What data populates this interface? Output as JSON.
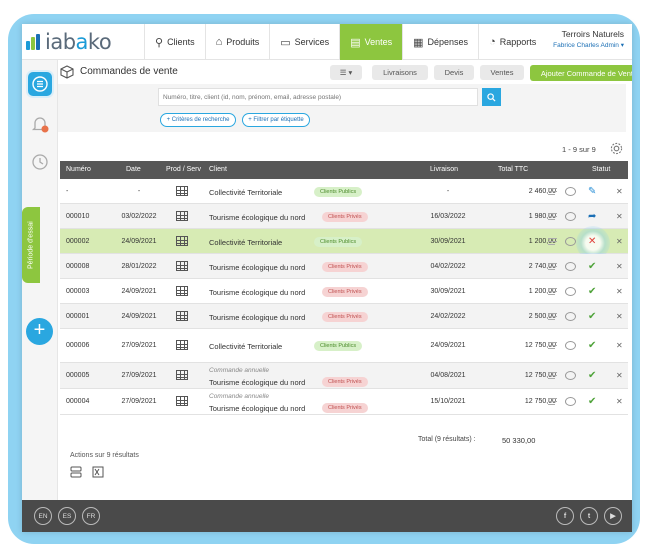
{
  "brand": {
    "logo_text_a": "iab",
    "logo_text_b": "a",
    "logo_text_c": "ko"
  },
  "nav": [
    {
      "label": "Clients",
      "icon": "person-icon"
    },
    {
      "label": "Produits",
      "icon": "tag-icon"
    },
    {
      "label": "Services",
      "icon": "briefcase-icon"
    },
    {
      "label": "Ventes",
      "icon": "document-icon",
      "active": true
    },
    {
      "label": "Dépenses",
      "icon": "calculator-icon"
    },
    {
      "label": "Rapports",
      "icon": "pie-chart-icon"
    }
  ],
  "account": {
    "company": "Terroirs Naturels",
    "user": "Fabrice Charles Admin"
  },
  "sidebar": {
    "trial_label": "Période d'essai",
    "notification_count": "6"
  },
  "page": {
    "title": "Commandes de vente",
    "buttons": {
      "livraisons": "Livraisons",
      "devis": "Devis",
      "ventes": "Ventes",
      "add": "Ajouter Commande de Vente"
    }
  },
  "search": {
    "placeholder": "Numéro, titre, client (id, nom, prénom, email, adresse postale)",
    "criteria_label": "+ Critères de recherche",
    "filter_label": "+ Filtrer par étiquette"
  },
  "pager": "1 - 9 sur 9",
  "table": {
    "headers": {
      "numero": "Numéro",
      "date": "Date",
      "prod": "Prod / Serv",
      "client": "Client",
      "livraison": "Livraison",
      "ttc": "Total TTC",
      "statut": "Statut"
    },
    "rows": [
      {
        "numero": "-",
        "date": "-",
        "sub": "",
        "client": "Collectivité Territoriale",
        "tag": "Clients Publics",
        "tag_type": "pub",
        "livraison": "-",
        "ttc": "2 460,00",
        "status": "edit"
      },
      {
        "numero": "000010",
        "date": "03/02/2022",
        "sub": "",
        "client": "Tourisme écologique du nord",
        "tag": "Clients Privés",
        "tag_type": "priv",
        "livraison": "16/03/2022",
        "ttc": "1 980,00",
        "status": "share"
      },
      {
        "numero": "000002",
        "date": "24/09/2021",
        "sub": "",
        "client": "Collectivité Territoriale",
        "tag": "Clients Publics",
        "tag_type": "pub",
        "livraison": "30/09/2021",
        "ttc": "1 200,00",
        "status": "cross"
      },
      {
        "numero": "000008",
        "date": "28/01/2022",
        "sub": "",
        "client": "Tourisme écologique du nord",
        "tag": "Clients Privés",
        "tag_type": "priv",
        "livraison": "04/02/2022",
        "ttc": "2 740,00",
        "status": "check"
      },
      {
        "numero": "000003",
        "date": "24/09/2021",
        "sub": "",
        "client": "Tourisme écologique du nord",
        "tag": "Clients Privés",
        "tag_type": "priv",
        "livraison": "30/09/2021",
        "ttc": "1 200,00",
        "status": "check"
      },
      {
        "numero": "000001",
        "date": "24/09/2021",
        "sub": "",
        "client": "Tourisme écologique du nord",
        "tag": "Clients Privés",
        "tag_type": "priv",
        "livraison": "24/02/2022",
        "ttc": "2 500,00",
        "status": "check"
      },
      {
        "numero": "000006",
        "date": "27/09/2021",
        "sub": "",
        "client": "Collectivité Territoriale",
        "tag": "Clients Publics",
        "tag_type": "pub",
        "livraison": "24/09/2021",
        "ttc": "12 750,00",
        "status": "check"
      },
      {
        "numero": "000005",
        "date": "27/09/2021",
        "sub": "Commande annuelle",
        "client": "Tourisme écologique du nord",
        "tag": "Clients Privés",
        "tag_type": "priv",
        "livraison": "04/08/2021",
        "ttc": "12 750,00",
        "status": "check"
      },
      {
        "numero": "000004",
        "date": "27/09/2021",
        "sub": "Commande annuelle",
        "client": "Tourisme écologique du nord",
        "tag": "Clients Privés",
        "tag_type": "priv",
        "livraison": "15/10/2021",
        "ttc": "12 750,00",
        "status": "check"
      }
    ]
  },
  "total": {
    "label": "Total (9 résultats) :",
    "value": "50 330,00"
  },
  "actions_label": "Actions sur 9 résultats",
  "footer": {
    "langs": [
      "EN",
      "ES",
      "FR"
    ],
    "social": [
      "facebook-icon",
      "twitter-icon",
      "youtube-icon"
    ]
  },
  "colors": {
    "accent_green": "#8dc63f",
    "accent_blue": "#2aa7e0",
    "highlight_row": "#d7ebb4",
    "header_dark": "#575757",
    "footer": "#4a4a4a"
  }
}
